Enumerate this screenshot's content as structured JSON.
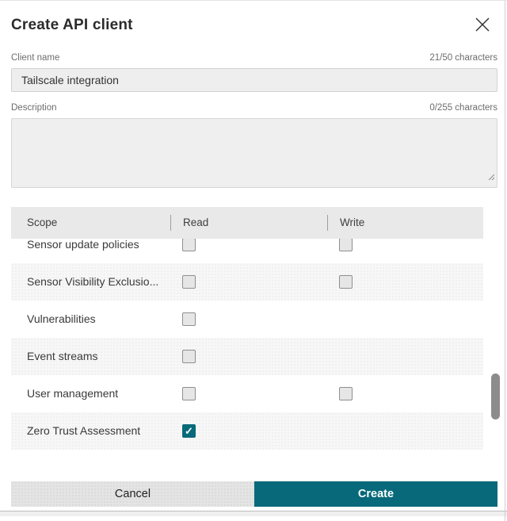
{
  "dialog": {
    "title": "Create API client"
  },
  "fields": {
    "client_name": {
      "label": "Client name",
      "counter": "21/50 characters",
      "value": "Tailscale integration"
    },
    "description": {
      "label": "Description",
      "counter": "0/255 characters",
      "value": ""
    }
  },
  "scopes_table": {
    "columns": {
      "scope": "Scope",
      "read": "Read",
      "write": "Write"
    },
    "rows": [
      {
        "name": "Sensor update policies",
        "read": "unchecked",
        "write": "unchecked"
      },
      {
        "name": "Sensor Visibility Exclusio...",
        "read": "unchecked",
        "write": "unchecked"
      },
      {
        "name": "Vulnerabilities",
        "read": "unchecked",
        "write": "none"
      },
      {
        "name": "Event streams",
        "read": "unchecked",
        "write": "none"
      },
      {
        "name": "User management",
        "read": "unchecked",
        "write": "unchecked"
      },
      {
        "name": "Zero Trust Assessment",
        "read": "checked",
        "write": "none"
      }
    ]
  },
  "footer": {
    "cancel_label": "Cancel",
    "create_label": "Create"
  },
  "colors": {
    "accent_teal": "#076979",
    "header_bg": "#e9e9e9",
    "alt_row_bg": "#f7f7f7",
    "input_bg": "#eeeeee"
  }
}
